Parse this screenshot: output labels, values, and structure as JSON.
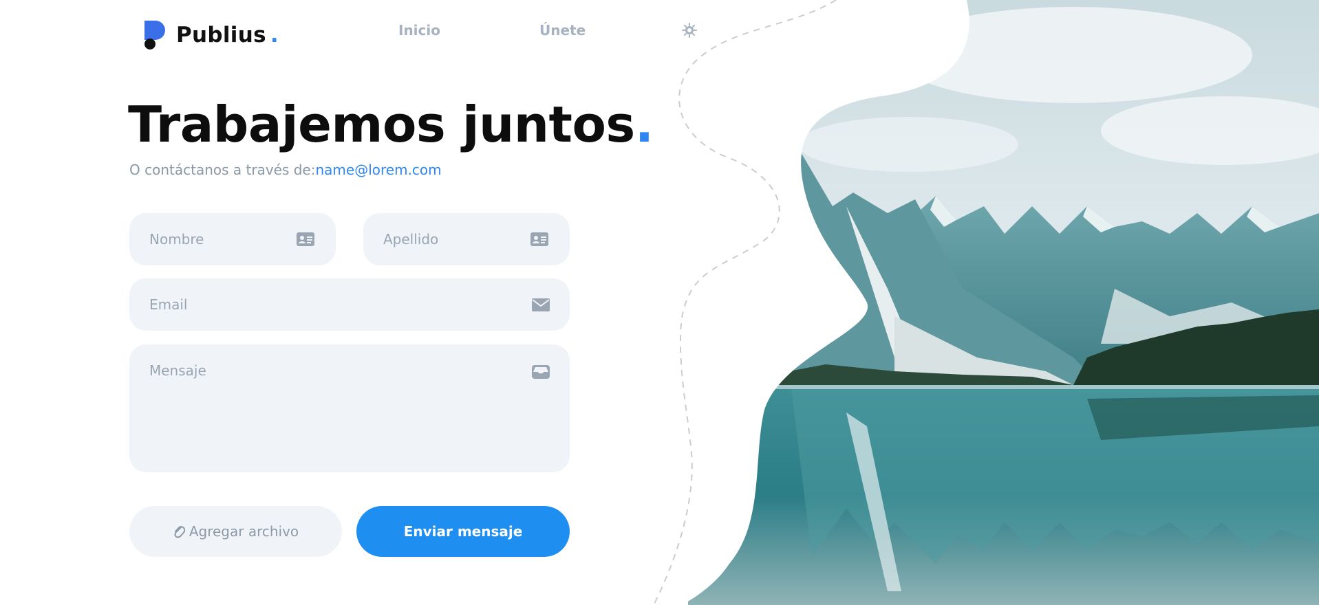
{
  "brand": {
    "name": "Publius",
    "dot": ".",
    "accent_color": "#2f86f2",
    "logo_color": "#3b6fe8"
  },
  "nav": {
    "home_label": "Inicio",
    "join_label": "Únete",
    "theme_icon": "sun-icon"
  },
  "hero": {
    "title": "Trabajemos juntos",
    "title_dot": ".",
    "subtitle": "O contáctanos a través de:",
    "email": "name@lorem.com"
  },
  "form": {
    "first_name_placeholder": "Nombre",
    "last_name_placeholder": "Apellido",
    "email_placeholder": "Email",
    "message_placeholder": "Mensaje",
    "attach_label": "Agregar archivo",
    "send_label": "Enviar mensaje",
    "field_background": "#f0f4f8",
    "send_color": "#1f8ef1"
  },
  "icons": {
    "first_name": "id-card-icon",
    "last_name": "id-card-icon",
    "email": "envelope-icon",
    "message": "inbox-icon",
    "attach": "paperclip-icon"
  },
  "scene": {
    "image": "mountain-lake-photo",
    "sky": "#dbe7ec",
    "water": "#2f8a93",
    "forest": "#1f3a2a"
  }
}
